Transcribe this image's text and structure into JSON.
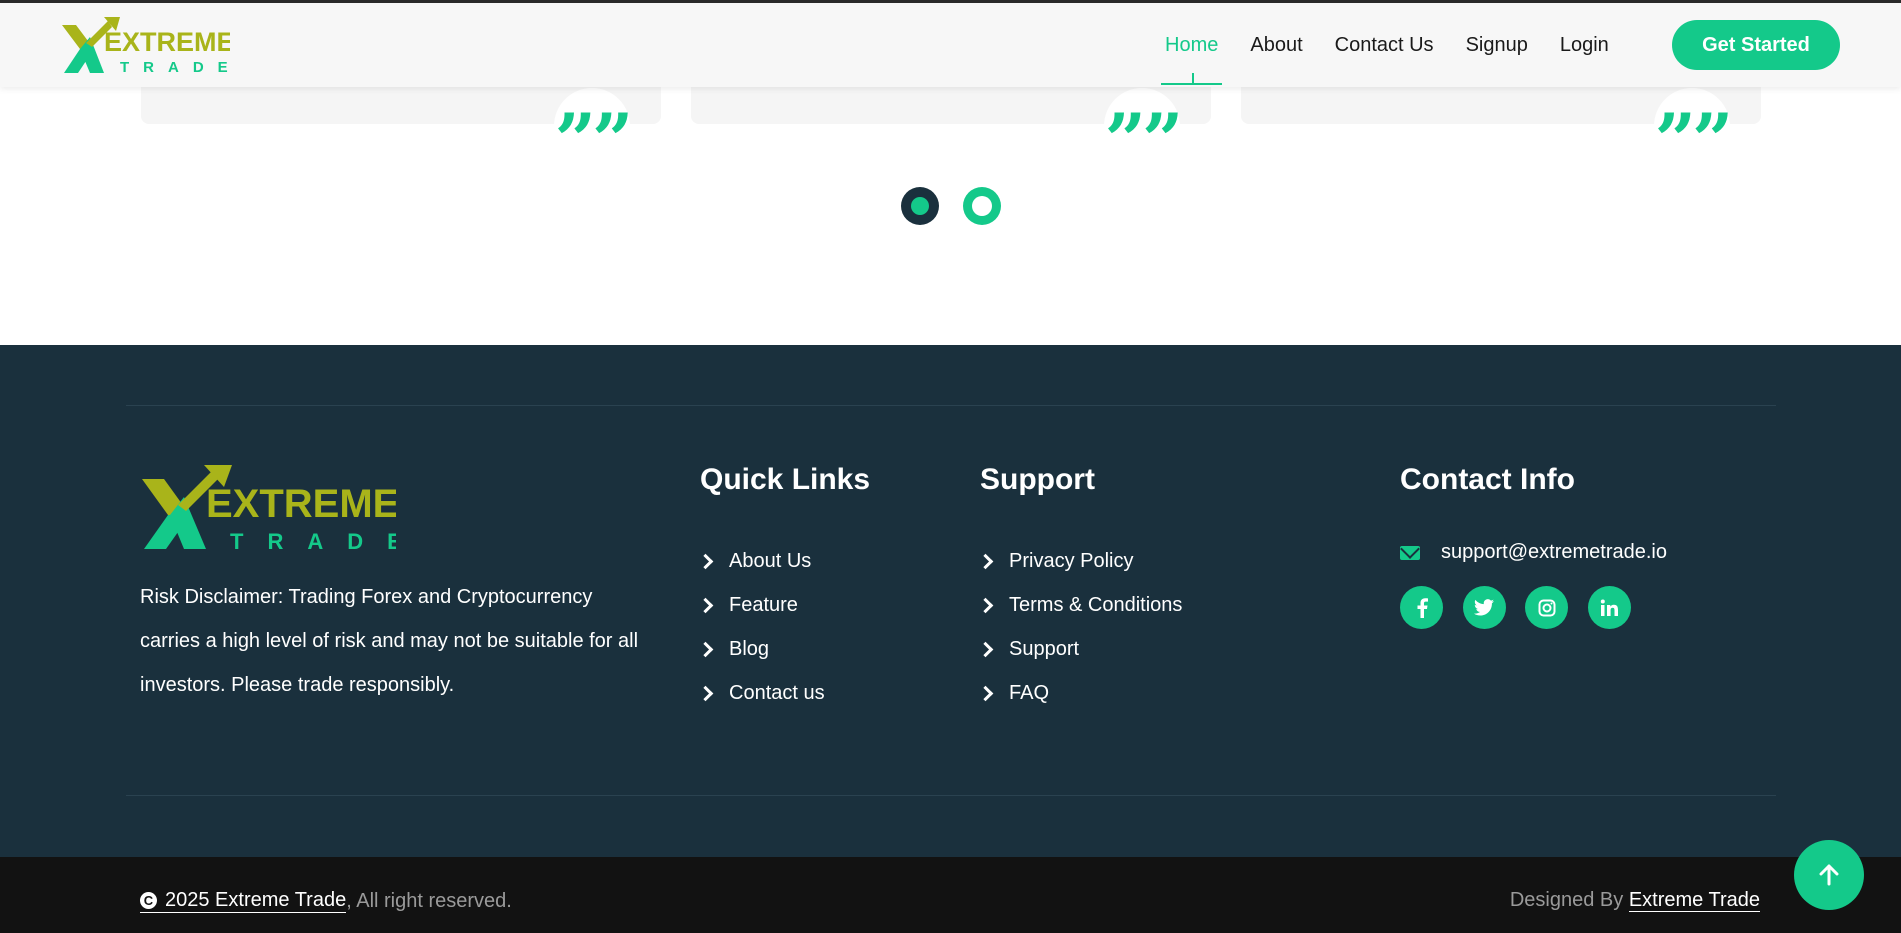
{
  "brand": {
    "name_top": "EXTREME",
    "name_bottom": "TRADE",
    "colors": {
      "accent": "#14c98a",
      "olive": "#a9b41a",
      "footer": "#1a303d",
      "bottom": "#121212"
    }
  },
  "nav": {
    "items": [
      {
        "label": "Home",
        "active": true
      },
      {
        "label": "About"
      },
      {
        "label": "Contact Us"
      },
      {
        "label": "Signup"
      },
      {
        "label": "Login"
      }
    ],
    "cta": "Get Started"
  },
  "testimonials": {
    "quote_glyph": "”",
    "slides": 2,
    "active_slide": 1
  },
  "footer": {
    "disclaimer": "Risk Disclaimer: Trading Forex and Cryptocurrency carries a high level of risk and may not be suitable for all investors. Please trade responsibly.",
    "quick_links": {
      "title": "Quick Links",
      "items": [
        "About Us",
        "Feature",
        "Blog",
        "Contact us"
      ]
    },
    "support": {
      "title": "Support",
      "items": [
        "Privacy Policy",
        "Terms & Conditions",
        "Support",
        "FAQ"
      ]
    },
    "contact": {
      "title": "Contact Info",
      "email": "support@extremetrade.io",
      "socials": [
        "facebook-icon",
        "twitter-icon",
        "instagram-icon",
        "linkedin-icon"
      ]
    }
  },
  "bottom": {
    "copyright_brand": "2025 Extreme Trade",
    "copyright_rest": ", All right reserved.",
    "designed_prefix": "Designed By ",
    "designed_brand": "Extreme Trade"
  }
}
